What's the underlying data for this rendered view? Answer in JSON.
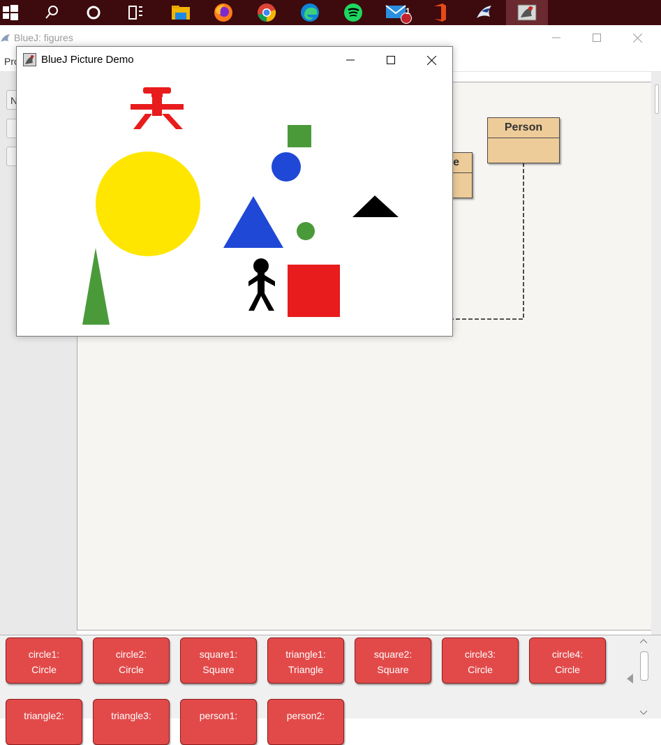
{
  "taskbar": {
    "icons": [
      "windows-start-icon",
      "search-icon",
      "cortana-icon",
      "task-view-icon",
      "file-explorer-icon",
      "firefox-icon",
      "chrome-icon",
      "edge-icon",
      "spotify-icon",
      "mail-icon",
      "office-icon",
      "bluej-icon",
      "bluej-picture-icon"
    ],
    "mail_badge": "1"
  },
  "bluej": {
    "title": "BlueJ:  figures",
    "menu_partial": "Pro",
    "left_button_partial": "N"
  },
  "classes": [
    {
      "name": "Person"
    },
    {
      "name": "e"
    }
  ],
  "demo": {
    "title": "BlueJ Picture Demo",
    "colors": {
      "red": "#e81c1c",
      "yellow": "#ffe600",
      "blue": "#1f48d6",
      "green": "#4a9a3a",
      "black": "#000000"
    }
  },
  "bench": {
    "objects": [
      {
        "line1": "circle1:",
        "line2": "Circle"
      },
      {
        "line1": "circle2:",
        "line2": "Circle"
      },
      {
        "line1": "square1:",
        "line2": "Square"
      },
      {
        "line1": "triangle1:",
        "line2": "Triangle"
      },
      {
        "line1": "square2:",
        "line2": "Square"
      },
      {
        "line1": "circle3:",
        "line2": "Circle"
      },
      {
        "line1": "circle4:",
        "line2": "Circle"
      },
      {
        "line1": "triangle2:",
        "line2": ""
      },
      {
        "line1": "triangle3:",
        "line2": ""
      },
      {
        "line1": "person1:",
        "line2": ""
      },
      {
        "line1": "person2:",
        "line2": ""
      }
    ]
  }
}
